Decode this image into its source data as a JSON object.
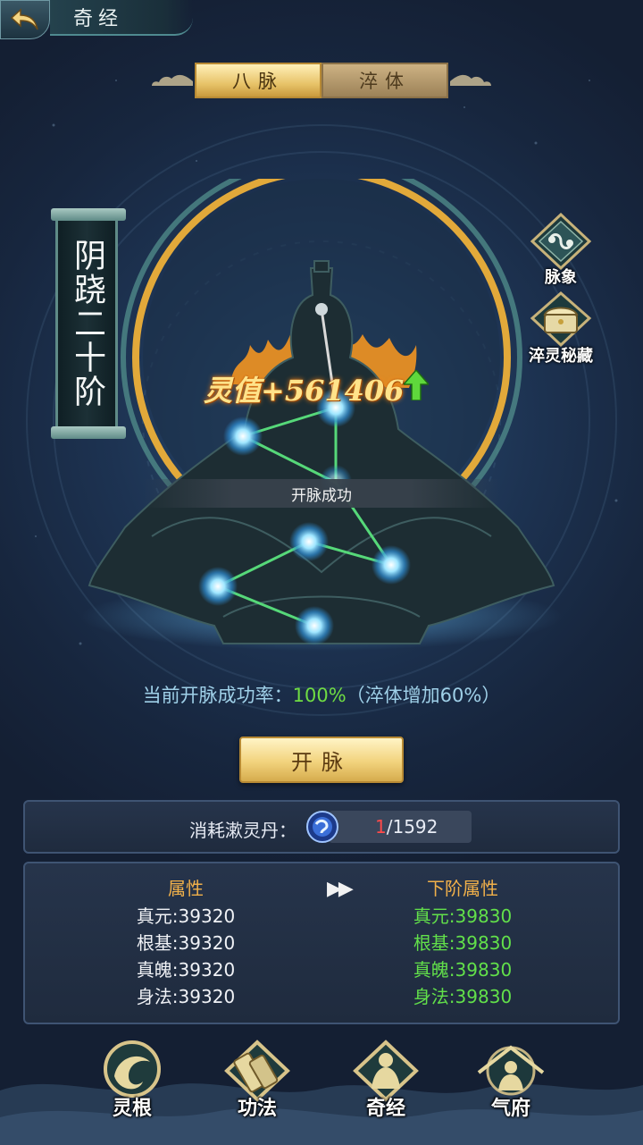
{
  "header": {
    "title": "奇经"
  },
  "tabs": [
    {
      "label": "八脉",
      "active": true
    },
    {
      "label": "淬体",
      "active": false
    }
  ],
  "rank": {
    "text": "阴跷二十阶"
  },
  "side_buttons": [
    {
      "label": "脉象",
      "icon": "meridian-pattern-icon"
    },
    {
      "label": "淬灵秘藏",
      "icon": "treasure-chest-icon"
    }
  ],
  "figure": {
    "spirit_value": "灵值+561406",
    "success_text": "开脉成功"
  },
  "rate": {
    "prefix": "当前开脉成功率：",
    "value": "100%",
    "suffix": "（淬体增加60%）"
  },
  "open_button": {
    "label": "开脉"
  },
  "consume": {
    "label": "消耗漱灵丹：",
    "current": "1",
    "total": "/1592"
  },
  "attributes": {
    "current_header": "属性",
    "next_header": "下阶属性",
    "arrows": "▶▶",
    "current": [
      "真元:39320",
      "根基:39320",
      "真魄:39320",
      "身法:39320"
    ],
    "next": [
      "真元:39830",
      "根基:39830",
      "真魄:39830",
      "身法:39830"
    ]
  },
  "nav": [
    {
      "label": "灵根",
      "icon": "spirit-root-icon"
    },
    {
      "label": "功法",
      "icon": "scroll-icon"
    },
    {
      "label": "奇经",
      "icon": "meridian-figure-icon"
    },
    {
      "label": "气府",
      "icon": "palace-icon"
    }
  ],
  "colors": {
    "accent_gold": "#e8c46a",
    "green": "#6fdc43",
    "red": "#ff4a4a",
    "header_orange": "#f0b04a"
  }
}
